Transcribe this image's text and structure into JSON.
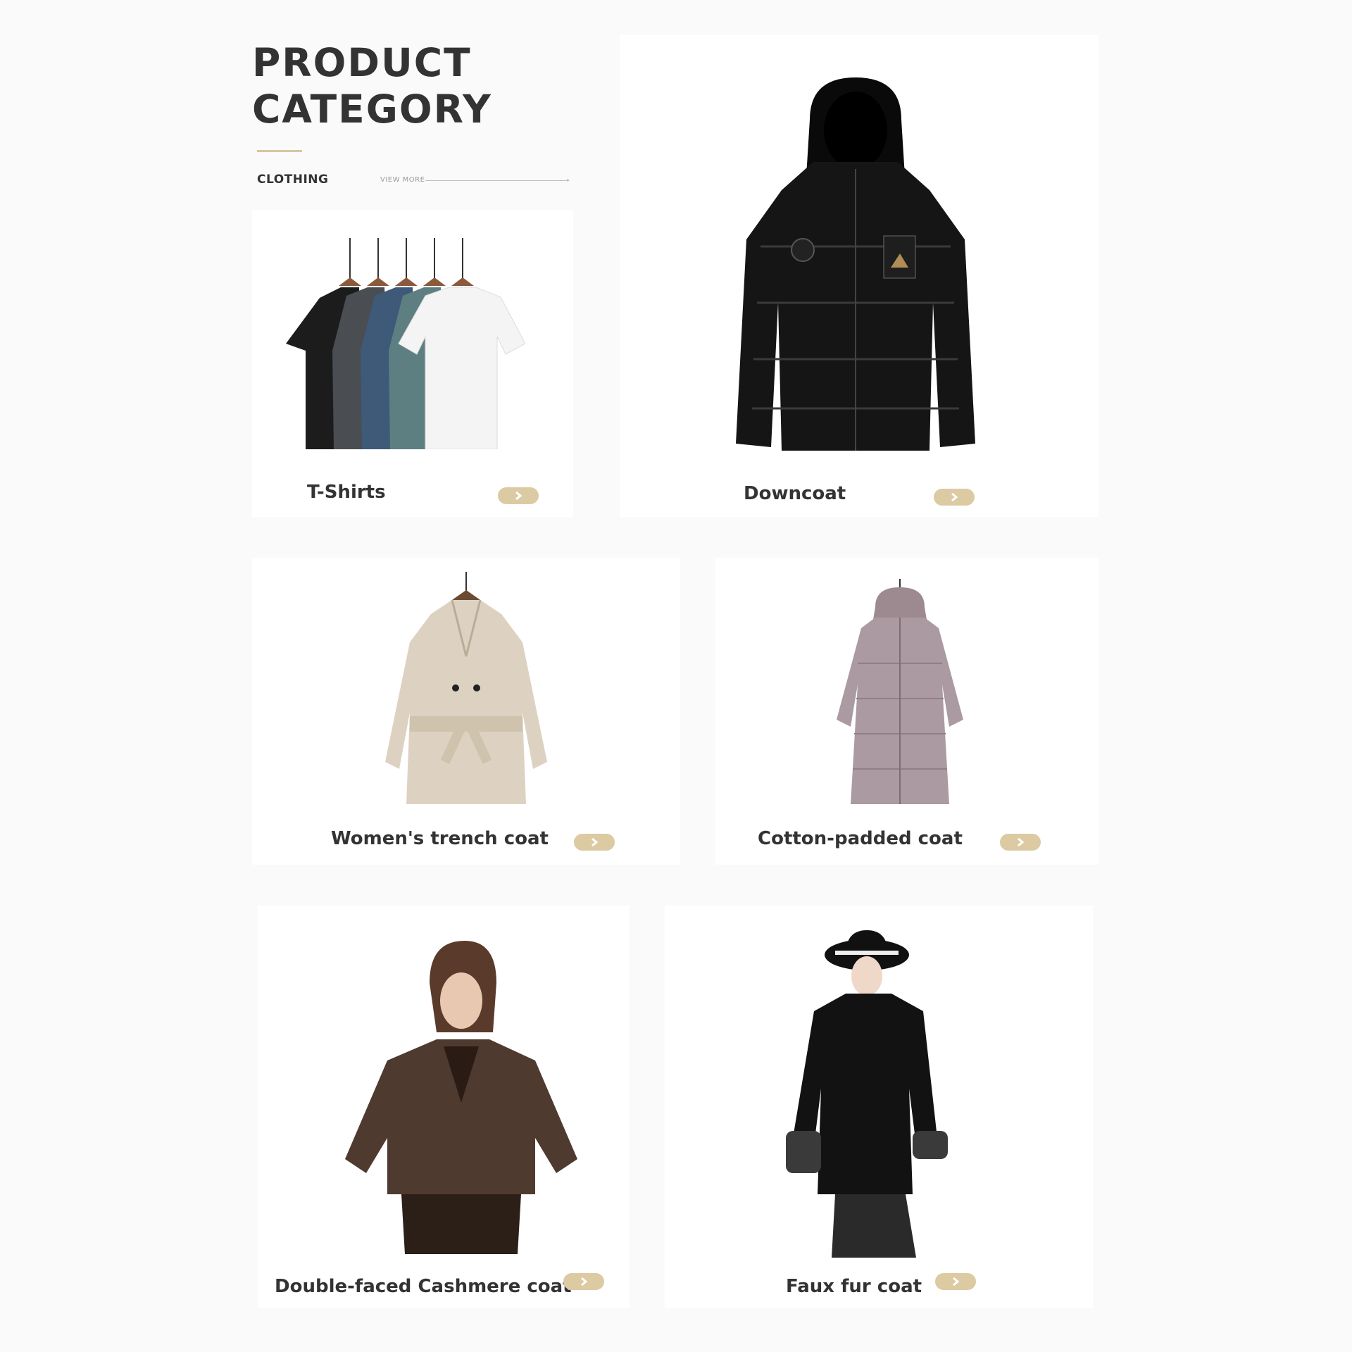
{
  "header": {
    "title_line1": "PRODUCT",
    "title_line2": "CATEGORY",
    "section": "CLOTHING",
    "view_more": "VIEW MORE"
  },
  "colors": {
    "accent": "#dccaa3",
    "text": "#333333",
    "background": "#fafafa",
    "card": "#ffffff"
  },
  "products": [
    {
      "name": "T-Shirts",
      "icon": "chevron-right-icon"
    },
    {
      "name": "Downcoat",
      "icon": "chevron-right-icon"
    },
    {
      "name": "Women's trench coat",
      "icon": "chevron-right-icon"
    },
    {
      "name": "Cotton-padded coat",
      "icon": "chevron-right-icon"
    },
    {
      "name": "Double-faced Cashmere coat",
      "icon": "chevron-right-icon"
    },
    {
      "name": "Faux fur coat",
      "icon": "chevron-right-icon"
    }
  ]
}
